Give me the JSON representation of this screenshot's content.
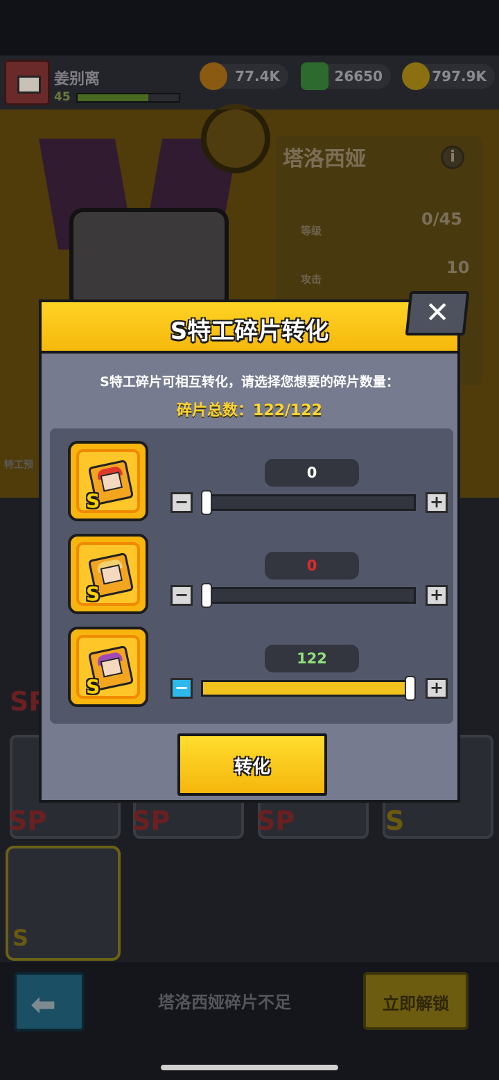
{
  "header": {
    "player_name": "姜别离",
    "player_level": "45",
    "resources": [
      {
        "icon": "flame-coin-icon",
        "value": "77.4K"
      },
      {
        "icon": "green-gem-icon",
        "value": "26650"
      },
      {
        "icon": "gold-coin-icon",
        "value": "797.9K"
      }
    ]
  },
  "hero": {
    "name": "塔洛西娅",
    "stats": [
      {
        "label": "等级",
        "value": "0/45"
      },
      {
        "label": "攻击",
        "value": "10"
      }
    ],
    "side_label": "特工预"
  },
  "grid": {
    "tags": [
      "SP",
      "SP",
      "SP",
      "SP",
      "S",
      "S"
    ]
  },
  "bottom": {
    "message": "塔洛西娅碎片不足",
    "unlock_label": "立即解锁"
  },
  "modal": {
    "title": "S特工碎片转化",
    "close_label": "✕",
    "description": "S特工碎片可相互转化，请选择您想要的碎片数量：",
    "total_text": "碎片总数：122/122",
    "rows": [
      {
        "count": "0",
        "count_color": "#ffffff",
        "fill_fraction": 0,
        "hair_color": "#e0382a",
        "minus_active": false
      },
      {
        "count": "0",
        "count_color": "#e02a2a",
        "fill_fraction": 0,
        "hair_color": "#f0d070",
        "minus_active": false
      },
      {
        "count": "122",
        "count_color": "#8fe07a",
        "fill_fraction": 1,
        "hair_color": "#a04ab8",
        "minus_active": true
      }
    ],
    "minus_label": "−",
    "plus_label": "+",
    "frag_badge": "S",
    "convert_label": "转化"
  },
  "colors": {
    "accent_yellow": "#f7b50d",
    "panel_gray": "#767b8f",
    "minus_active_blue": "#2eb9ea"
  }
}
